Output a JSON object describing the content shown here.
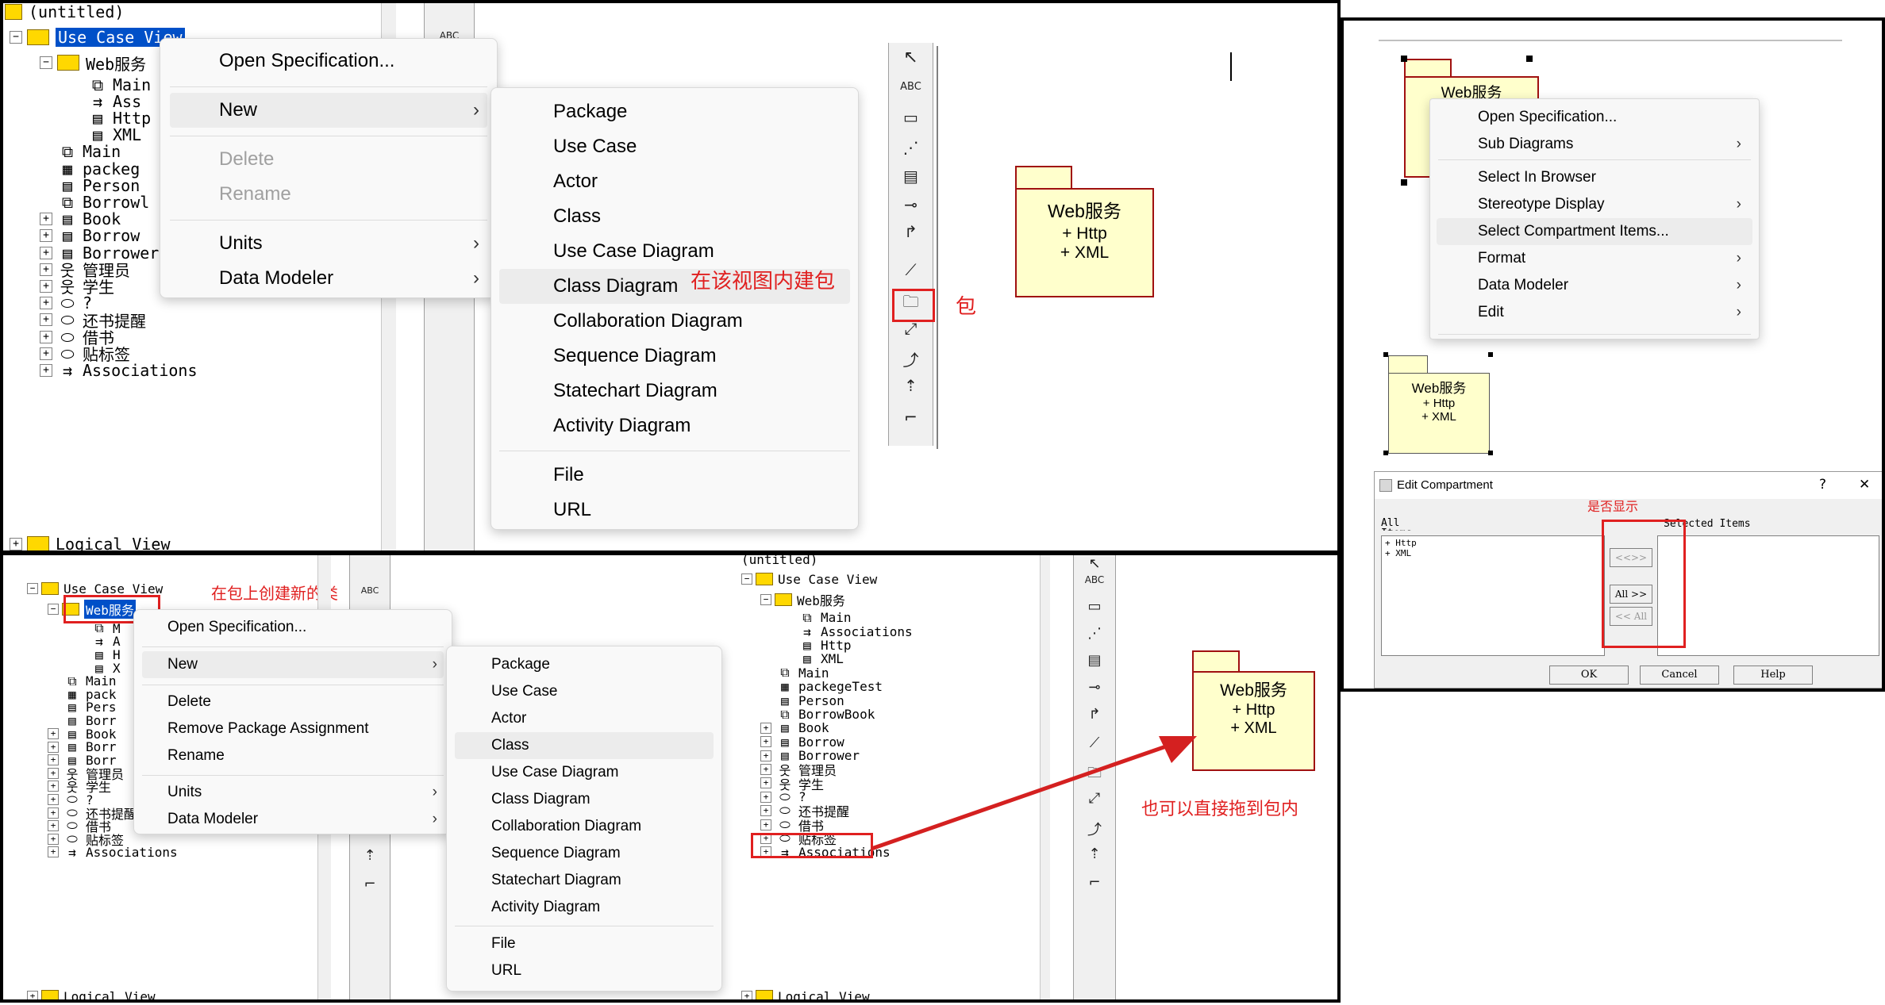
{
  "panel1": {
    "tree": {
      "root_label": "(untitled)",
      "use_case_view": "Use Case View",
      "web_service": "Web服务",
      "items": [
        "Main",
        "Ass",
        "Http",
        "XML",
        "Main",
        "packeg",
        "Person",
        "Borrowl",
        "Book",
        "Borrow",
        "Borrower",
        "管理员",
        "学生",
        "?",
        "还书提醒",
        "借书",
        "贴标签",
        "Associations"
      ],
      "bottom_label": "Logical View"
    },
    "context_menu": {
      "open_spec": "Open Specification...",
      "new": "New",
      "delete": "Delete",
      "rename": "Rename",
      "units": "Units",
      "data_modeler": "Data Modeler"
    },
    "submenu": [
      "Package",
      "Use Case",
      "Actor",
      "Class",
      "Use Case Diagram",
      "Class Diagram",
      "Collaboration Diagram",
      "Sequence Diagram",
      "Statechart Diagram",
      "Activity Diagram",
      "File",
      "URL"
    ],
    "annotation_create_pkg": "在该视图内建包",
    "annotation_pkg": "包",
    "toolbar_abc": "ABC",
    "package": {
      "name": "Web服务",
      "items": [
        "+ Http",
        "+ XML"
      ]
    }
  },
  "panel2": {
    "package_top": {
      "name": "Web服务"
    },
    "context_menu": [
      "Open Specification...",
      "Sub Diagrams",
      "Select In Browser",
      "Stereotype Display",
      "Select Compartment Items...",
      "Format",
      "Data Modeler",
      "Edit"
    ],
    "package_small": {
      "name": "Web服务",
      "items": [
        "+ Http",
        "+ XML"
      ]
    },
    "dialog": {
      "title": "Edit Compartment",
      "help_glyph": "?",
      "close_glyph": "✕",
      "annotation": "是否显示",
      "all_items_label": "All Items",
      "selected_label": "Selected Items",
      "list_items": [
        "+ Http",
        "+ XML"
      ],
      "btn_move": "<<>>",
      "btn_all": "All >>",
      "btn_remove_all": "<< All",
      "ok": "OK",
      "cancel": "Cancel",
      "help": "Help"
    }
  },
  "panel3": {
    "tree_left": {
      "use_case_view": "Use Case View",
      "web_service": "Web服务",
      "items": [
        "M",
        "A",
        "H",
        "X",
        "Main",
        "pack",
        "Pers",
        "Borr",
        "Book",
        "Borr",
        "Borr",
        "管理员",
        "学生",
        "?",
        "还书提醒",
        "借书",
        "贴标签",
        "Associations"
      ],
      "bottom_label": "Logical View"
    },
    "annotation_create_class": "在包上创建新的类",
    "context_menu": {
      "open_spec": "Open Specification...",
      "new": "New",
      "delete": "Delete",
      "remove_pkg": "Remove Package Assignment",
      "rename": "Rename",
      "units": "Units",
      "data_modeler": "Data Modeler"
    },
    "submenu": [
      "Package",
      "Use Case",
      "Actor",
      "Class",
      "Use Case Diagram",
      "Class Diagram",
      "Collaboration Diagram",
      "Sequence Diagram",
      "Statechart Diagram",
      "Activity Diagram",
      "File",
      "URL"
    ],
    "tree_right": {
      "root_label": "(untitled)",
      "use_case_view": "Use Case View",
      "web_service": "Web服务",
      "items": [
        "Main",
        "Associations",
        "Http",
        "XML",
        "Main",
        "packegeTest",
        "Person",
        "BorrowBook",
        "Book",
        "Borrow",
        "Borrower",
        "管理员",
        "学生",
        "?",
        "还书提醒",
        "借书",
        "贴标签",
        "Associations"
      ],
      "bottom_label": "Logical View"
    },
    "toolbar_abc": "ABC",
    "package": {
      "name": "Web服务",
      "items": [
        "+ Http",
        "+ XML"
      ]
    },
    "annotation_drag": "也可以直接拖到包内"
  }
}
